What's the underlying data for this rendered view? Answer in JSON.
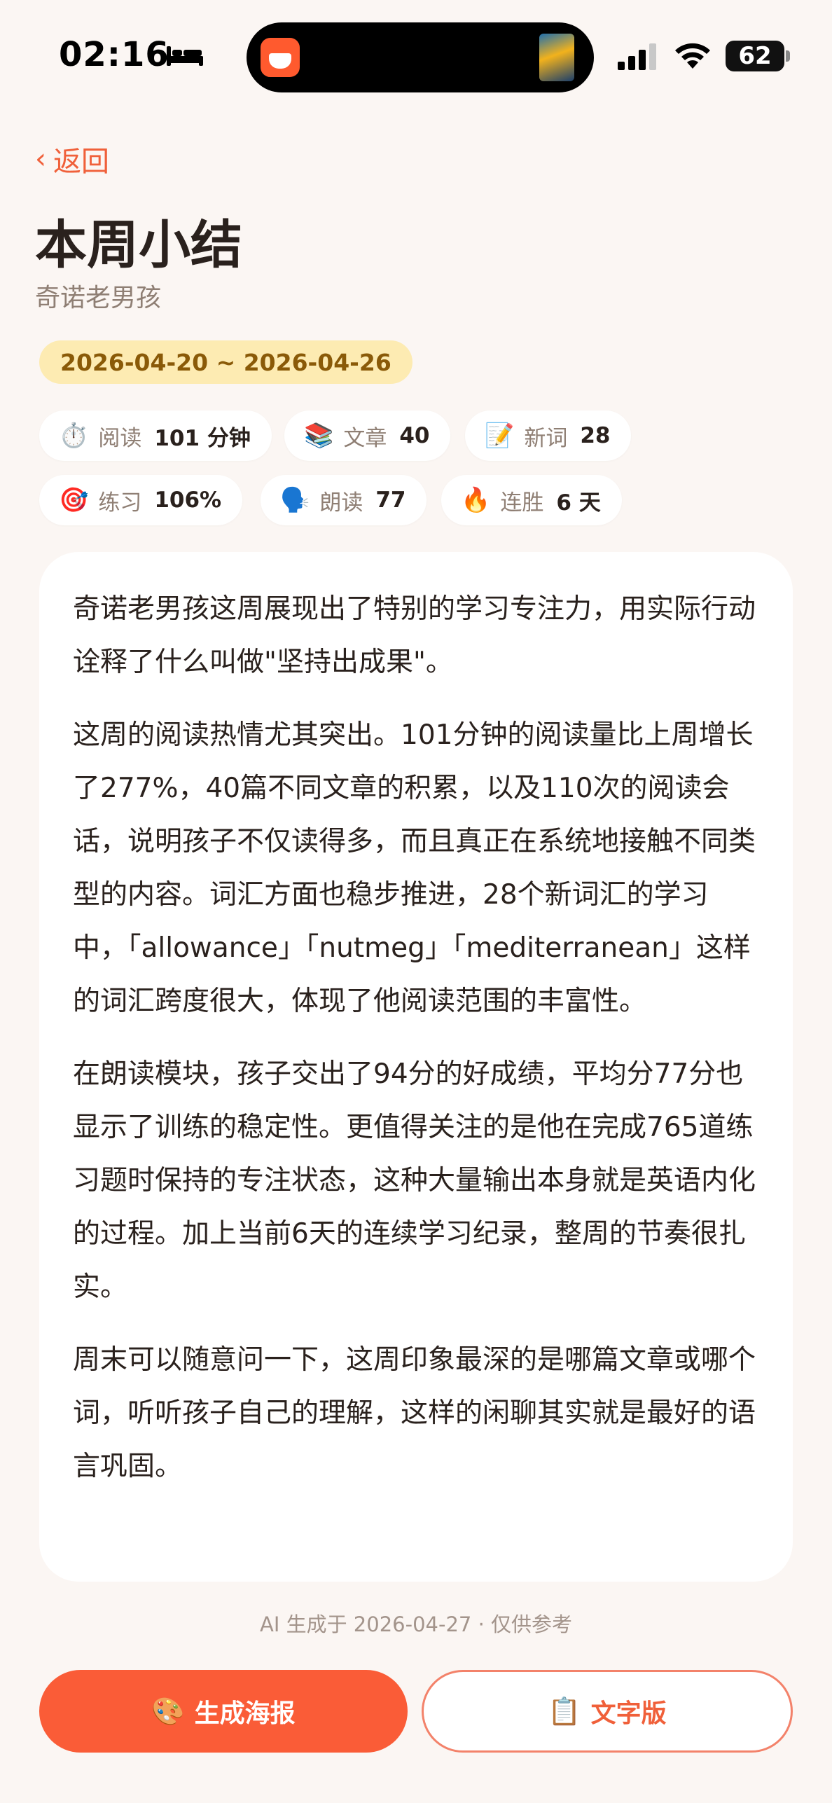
{
  "status_bar": {
    "time": "02:16",
    "battery": "62"
  },
  "header": {
    "back_chevron": "‹",
    "back_label": "返回",
    "title": "本周小结",
    "subtitle": "奇诺老男孩",
    "date_range": "2026-04-20 ~ 2026-04-26"
  },
  "stats": [
    {
      "icon": "stopwatch-icon",
      "emoji": "⏱️",
      "label": "阅读",
      "value": "101 分钟"
    },
    {
      "icon": "books-icon",
      "emoji": "📚",
      "label": "文章",
      "value": "40"
    },
    {
      "icon": "memo-icon",
      "emoji": "📝",
      "label": "新词",
      "value": "28"
    },
    {
      "icon": "target-icon",
      "emoji": "🎯",
      "label": "练习",
      "value": "106%"
    },
    {
      "icon": "speaking-head-icon",
      "emoji": "🗣️",
      "label": "朗读",
      "value": "77"
    },
    {
      "icon": "fire-icon",
      "emoji": "🔥",
      "label": "连胜",
      "value": "6 天"
    }
  ],
  "summary": {
    "paragraphs": [
      "奇诺老男孩这周展现出了特别的学习专注力，用实际行动诠释了什么叫做\"坚持出成果\"。",
      "这周的阅读热情尤其突出。101分钟的阅读量比上周增长了277%，40篇不同文章的积累，以及110次的阅读会话，说明孩子不仅读得多，而且真正在系统地接触不同类型的内容。词汇方面也稳步推进，28个新词汇的学习中，「allowance」「nutmeg」「mediterranean」这样的词汇跨度很大，体现了他阅读范围的丰富性。",
      "在朗读模块，孩子交出了94分的好成绩，平均分77分也显示了训练的稳定性。更值得关注的是他在完成765道练习题时保持的专注状态，这种大量输出本身就是英语内化的过程。加上当前6天的连续学习纪录，整周的节奏很扎实。",
      "周末可以随意问一下，这周印象最深的是哪篇文章或哪个词，听听孩子自己的理解，这样的闲聊其实就是最好的语言巩固。"
    ]
  },
  "footnote": "AI 生成于 2026-04-27 · 仅供参考",
  "actions": {
    "poster_emoji": "🎨",
    "poster_label": "生成海报",
    "text_emoji": "📋",
    "text_label": "文字版"
  },
  "colors": {
    "accent": "#fa5c37",
    "background": "#fbf6f3",
    "date_chip": "#fdebb2"
  }
}
